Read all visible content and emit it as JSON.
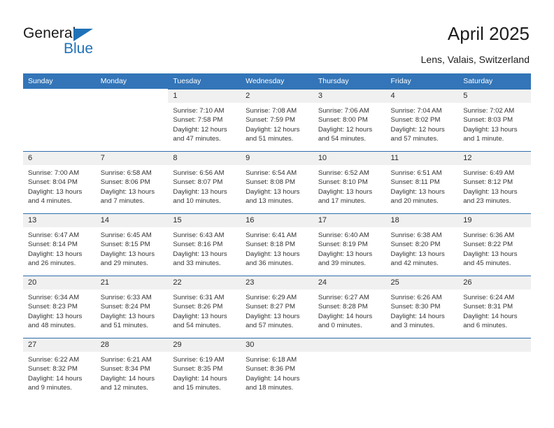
{
  "brand": {
    "name_top": "General",
    "name_bottom": "Blue",
    "accent_color": "#2072b8"
  },
  "header": {
    "title": "April 2025",
    "subtitle": "Lens, Valais, Switzerland"
  },
  "theme": {
    "header_row_color": "#3375b8",
    "row_border_color": "#2f6fad",
    "daynum_band_color": "#f0f0f0"
  },
  "calendar": {
    "weekday_headers": [
      "Sunday",
      "Monday",
      "Tuesday",
      "Wednesday",
      "Thursday",
      "Friday",
      "Saturday"
    ],
    "weeks": [
      [
        {
          "empty": true
        },
        {
          "empty": true
        },
        {
          "day": "1",
          "sunrise": "Sunrise: 7:10 AM",
          "sunset": "Sunset: 7:58 PM",
          "daylight": "Daylight: 12 hours and 47 minutes."
        },
        {
          "day": "2",
          "sunrise": "Sunrise: 7:08 AM",
          "sunset": "Sunset: 7:59 PM",
          "daylight": "Daylight: 12 hours and 51 minutes."
        },
        {
          "day": "3",
          "sunrise": "Sunrise: 7:06 AM",
          "sunset": "Sunset: 8:00 PM",
          "daylight": "Daylight: 12 hours and 54 minutes."
        },
        {
          "day": "4",
          "sunrise": "Sunrise: 7:04 AM",
          "sunset": "Sunset: 8:02 PM",
          "daylight": "Daylight: 12 hours and 57 minutes."
        },
        {
          "day": "5",
          "sunrise": "Sunrise: 7:02 AM",
          "sunset": "Sunset: 8:03 PM",
          "daylight": "Daylight: 13 hours and 1 minute."
        }
      ],
      [
        {
          "day": "6",
          "sunrise": "Sunrise: 7:00 AM",
          "sunset": "Sunset: 8:04 PM",
          "daylight": "Daylight: 13 hours and 4 minutes."
        },
        {
          "day": "7",
          "sunrise": "Sunrise: 6:58 AM",
          "sunset": "Sunset: 8:06 PM",
          "daylight": "Daylight: 13 hours and 7 minutes."
        },
        {
          "day": "8",
          "sunrise": "Sunrise: 6:56 AM",
          "sunset": "Sunset: 8:07 PM",
          "daylight": "Daylight: 13 hours and 10 minutes."
        },
        {
          "day": "9",
          "sunrise": "Sunrise: 6:54 AM",
          "sunset": "Sunset: 8:08 PM",
          "daylight": "Daylight: 13 hours and 13 minutes."
        },
        {
          "day": "10",
          "sunrise": "Sunrise: 6:52 AM",
          "sunset": "Sunset: 8:10 PM",
          "daylight": "Daylight: 13 hours and 17 minutes."
        },
        {
          "day": "11",
          "sunrise": "Sunrise: 6:51 AM",
          "sunset": "Sunset: 8:11 PM",
          "daylight": "Daylight: 13 hours and 20 minutes."
        },
        {
          "day": "12",
          "sunrise": "Sunrise: 6:49 AM",
          "sunset": "Sunset: 8:12 PM",
          "daylight": "Daylight: 13 hours and 23 minutes."
        }
      ],
      [
        {
          "day": "13",
          "sunrise": "Sunrise: 6:47 AM",
          "sunset": "Sunset: 8:14 PM",
          "daylight": "Daylight: 13 hours and 26 minutes."
        },
        {
          "day": "14",
          "sunrise": "Sunrise: 6:45 AM",
          "sunset": "Sunset: 8:15 PM",
          "daylight": "Daylight: 13 hours and 29 minutes."
        },
        {
          "day": "15",
          "sunrise": "Sunrise: 6:43 AM",
          "sunset": "Sunset: 8:16 PM",
          "daylight": "Daylight: 13 hours and 33 minutes."
        },
        {
          "day": "16",
          "sunrise": "Sunrise: 6:41 AM",
          "sunset": "Sunset: 8:18 PM",
          "daylight": "Daylight: 13 hours and 36 minutes."
        },
        {
          "day": "17",
          "sunrise": "Sunrise: 6:40 AM",
          "sunset": "Sunset: 8:19 PM",
          "daylight": "Daylight: 13 hours and 39 minutes."
        },
        {
          "day": "18",
          "sunrise": "Sunrise: 6:38 AM",
          "sunset": "Sunset: 8:20 PM",
          "daylight": "Daylight: 13 hours and 42 minutes."
        },
        {
          "day": "19",
          "sunrise": "Sunrise: 6:36 AM",
          "sunset": "Sunset: 8:22 PM",
          "daylight": "Daylight: 13 hours and 45 minutes."
        }
      ],
      [
        {
          "day": "20",
          "sunrise": "Sunrise: 6:34 AM",
          "sunset": "Sunset: 8:23 PM",
          "daylight": "Daylight: 13 hours and 48 minutes."
        },
        {
          "day": "21",
          "sunrise": "Sunrise: 6:33 AM",
          "sunset": "Sunset: 8:24 PM",
          "daylight": "Daylight: 13 hours and 51 minutes."
        },
        {
          "day": "22",
          "sunrise": "Sunrise: 6:31 AM",
          "sunset": "Sunset: 8:26 PM",
          "daylight": "Daylight: 13 hours and 54 minutes."
        },
        {
          "day": "23",
          "sunrise": "Sunrise: 6:29 AM",
          "sunset": "Sunset: 8:27 PM",
          "daylight": "Daylight: 13 hours and 57 minutes."
        },
        {
          "day": "24",
          "sunrise": "Sunrise: 6:27 AM",
          "sunset": "Sunset: 8:28 PM",
          "daylight": "Daylight: 14 hours and 0 minutes."
        },
        {
          "day": "25",
          "sunrise": "Sunrise: 6:26 AM",
          "sunset": "Sunset: 8:30 PM",
          "daylight": "Daylight: 14 hours and 3 minutes."
        },
        {
          "day": "26",
          "sunrise": "Sunrise: 6:24 AM",
          "sunset": "Sunset: 8:31 PM",
          "daylight": "Daylight: 14 hours and 6 minutes."
        }
      ],
      [
        {
          "day": "27",
          "sunrise": "Sunrise: 6:22 AM",
          "sunset": "Sunset: 8:32 PM",
          "daylight": "Daylight: 14 hours and 9 minutes."
        },
        {
          "day": "28",
          "sunrise": "Sunrise: 6:21 AM",
          "sunset": "Sunset: 8:34 PM",
          "daylight": "Daylight: 14 hours and 12 minutes."
        },
        {
          "day": "29",
          "sunrise": "Sunrise: 6:19 AM",
          "sunset": "Sunset: 8:35 PM",
          "daylight": "Daylight: 14 hours and 15 minutes."
        },
        {
          "day": "30",
          "sunrise": "Sunrise: 6:18 AM",
          "sunset": "Sunset: 8:36 PM",
          "daylight": "Daylight: 14 hours and 18 minutes."
        },
        {
          "empty": true,
          "trailing": true
        },
        {
          "empty": true,
          "trailing": true
        },
        {
          "empty": true,
          "trailing": true
        }
      ]
    ]
  }
}
